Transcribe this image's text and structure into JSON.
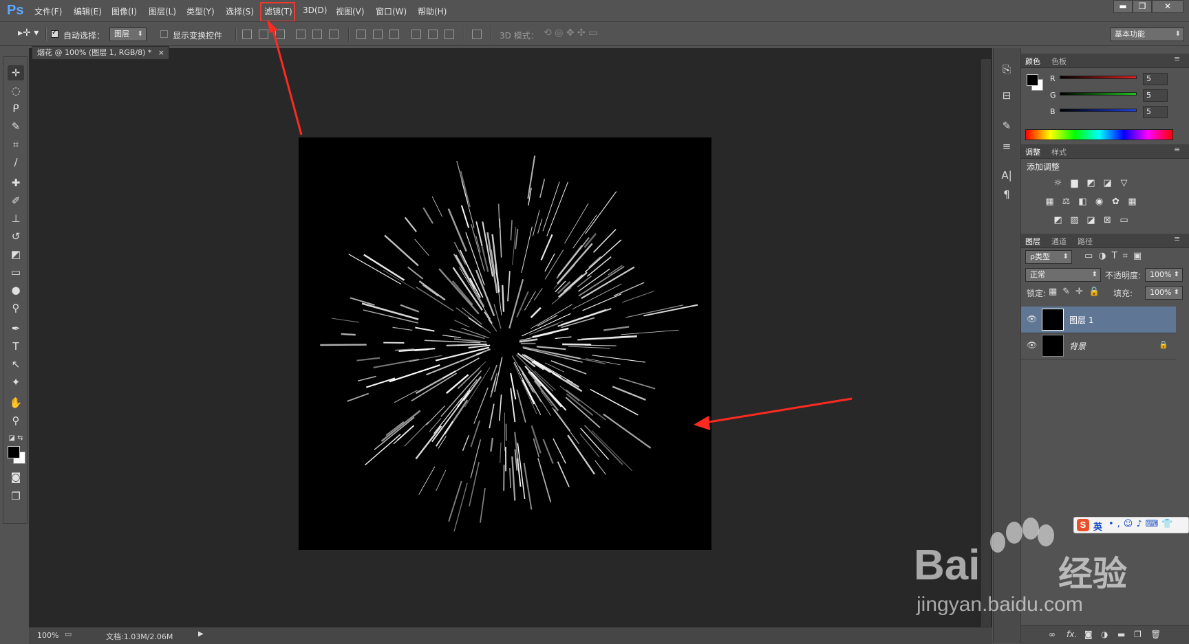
{
  "app": {
    "logo": "Ps"
  },
  "menu": {
    "items": [
      "文件(F)",
      "编辑(E)",
      "图像(I)",
      "图层(L)",
      "类型(Y)",
      "选择(S)",
      "滤镜(T)",
      "3D(D)",
      "视图(V)",
      "窗口(W)",
      "帮助(H)"
    ],
    "highlighted": "滤镜(T)"
  },
  "window_controls": {
    "minimize": "▬",
    "restore": "❐",
    "close": "✕"
  },
  "options_bar": {
    "auto_select_label": "自动选择：",
    "auto_select_target": "图层",
    "show_transform_label": "显示变换控件",
    "mode_3d_label": "3D 模式：",
    "workspace": "基本功能"
  },
  "document": {
    "tab_title": "烟花 @ 100% (图层 1, RGB/8) *",
    "tab_close": "×",
    "zoom": "100%",
    "doc_info": "文档:1.03M/2.06M"
  },
  "color_panel": {
    "tabs": [
      "颜色",
      "色板"
    ],
    "channels": [
      {
        "label": "R",
        "value": "5",
        "color": "#e02020"
      },
      {
        "label": "G",
        "value": "5",
        "color": "#1ec21e"
      },
      {
        "label": "B",
        "value": "5",
        "color": "#2040e0"
      }
    ]
  },
  "adjust_panel": {
    "tabs": [
      "调整",
      "样式"
    ],
    "title": "添加调整"
  },
  "layers_panel": {
    "tabs": [
      "图层",
      "通道",
      "路径"
    ],
    "filter_kind": "ρ类型",
    "blend_mode": "正常",
    "opacity_label": "不透明度:",
    "opacity_value": "100%",
    "lock_label": "锁定:",
    "fill_label": "填充:",
    "fill_value": "100%",
    "layers": [
      {
        "name": "图层 1",
        "selected": true,
        "locked": false
      },
      {
        "name": "背景",
        "selected": false,
        "locked": true
      }
    ]
  },
  "watermark": {
    "brand": "Bai",
    "brand_cn": "经验",
    "url": "jingyan.baidu.com"
  },
  "ime": {
    "label": "英"
  },
  "accent": {
    "highlight_red": "#e83a30",
    "selected_layer": "#5f7795"
  }
}
